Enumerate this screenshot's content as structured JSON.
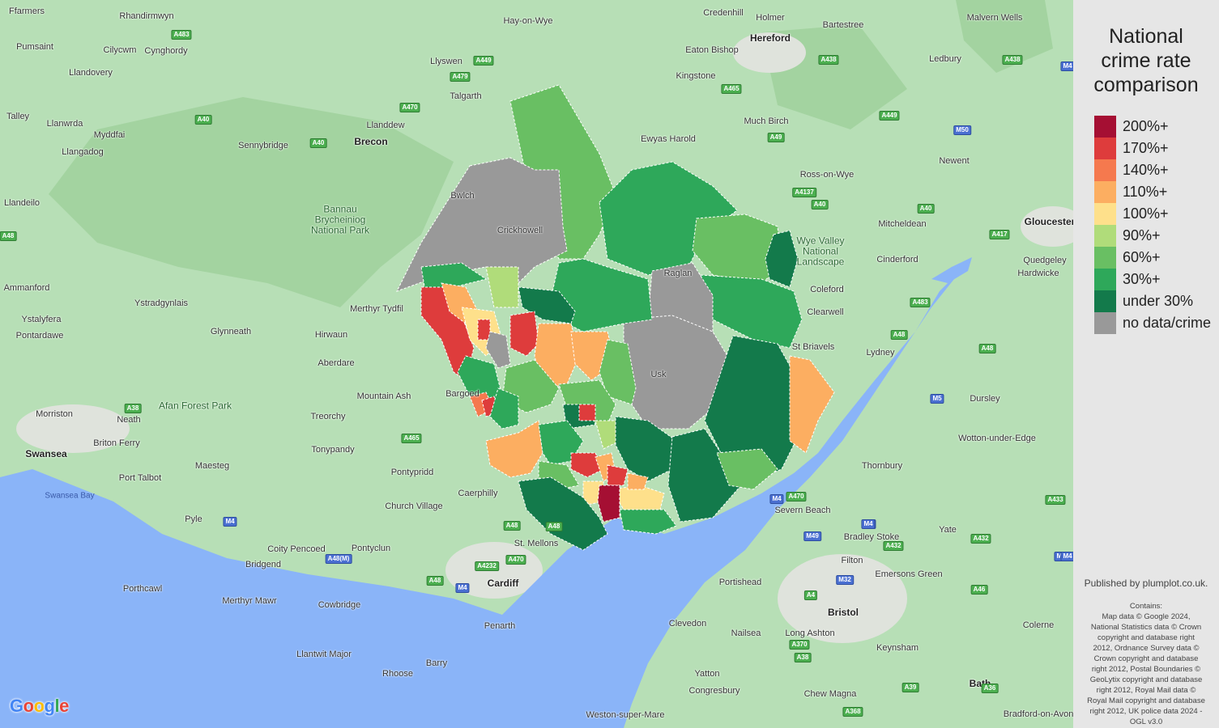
{
  "map": {
    "places": [
      {
        "name": "Ffarmers",
        "cls": ""
      },
      {
        "name": "Rhandirmwyn",
        "cls": ""
      },
      {
        "name": "Hay-on-Wye",
        "cls": ""
      },
      {
        "name": "Credenhill",
        "cls": ""
      },
      {
        "name": "Holmer",
        "cls": ""
      },
      {
        "name": "Hereford",
        "cls": "big"
      },
      {
        "name": "Bartestree",
        "cls": ""
      },
      {
        "name": "Malvern Wells",
        "cls": ""
      },
      {
        "name": "Pumsaint",
        "cls": ""
      },
      {
        "name": "Cilycwm",
        "cls": ""
      },
      {
        "name": "Cynghordy",
        "cls": ""
      },
      {
        "name": "Llyswen",
        "cls": ""
      },
      {
        "name": "Eaton Bishop",
        "cls": ""
      },
      {
        "name": "Ledbury",
        "cls": ""
      },
      {
        "name": "Llandovery",
        "cls": ""
      },
      {
        "name": "Talgarth",
        "cls": ""
      },
      {
        "name": "Kingstone",
        "cls": ""
      },
      {
        "name": "Talley",
        "cls": ""
      },
      {
        "name": "Llanwrda",
        "cls": ""
      },
      {
        "name": "Much Birch",
        "cls": ""
      },
      {
        "name": "Myddfai",
        "cls": ""
      },
      {
        "name": "Llanddew",
        "cls": ""
      },
      {
        "name": "Llangadog",
        "cls": ""
      },
      {
        "name": "Sennybridge",
        "cls": ""
      },
      {
        "name": "Brecon",
        "cls": "big"
      },
      {
        "name": "Ewyas Harold",
        "cls": ""
      },
      {
        "name": "Ross-on-Wye",
        "cls": ""
      },
      {
        "name": "Newent",
        "cls": ""
      },
      {
        "name": "Llandeilo",
        "cls": ""
      },
      {
        "name": "Bwlch",
        "cls": ""
      },
      {
        "name": "Crickhowell",
        "cls": ""
      },
      {
        "name": "Mitcheldean",
        "cls": ""
      },
      {
        "name": "Gloucester",
        "cls": "big"
      },
      {
        "name": "Cinderford",
        "cls": ""
      },
      {
        "name": "Quedgeley",
        "cls": ""
      },
      {
        "name": "Hardwicke",
        "cls": ""
      },
      {
        "name": "Coleford",
        "cls": ""
      },
      {
        "name": "Ammanford",
        "cls": ""
      },
      {
        "name": "Ystradgynlais",
        "cls": ""
      },
      {
        "name": "Clearwell",
        "cls": ""
      },
      {
        "name": "Ystalyfera",
        "cls": ""
      },
      {
        "name": "Merthyr Tydfil",
        "cls": ""
      },
      {
        "name": "Raglan",
        "cls": ""
      },
      {
        "name": "Glynneath",
        "cls": ""
      },
      {
        "name": "Hirwaun",
        "cls": ""
      },
      {
        "name": "Pontardawe",
        "cls": ""
      },
      {
        "name": "St Briavels",
        "cls": ""
      },
      {
        "name": "Lydney",
        "cls": ""
      },
      {
        "name": "Aberdare",
        "cls": ""
      },
      {
        "name": "Usk",
        "cls": ""
      },
      {
        "name": "Mountain Ash",
        "cls": ""
      },
      {
        "name": "Dursley",
        "cls": ""
      },
      {
        "name": "Bargoed",
        "cls": ""
      },
      {
        "name": "Morriston",
        "cls": ""
      },
      {
        "name": "Neath",
        "cls": ""
      },
      {
        "name": "Treorchy",
        "cls": ""
      },
      {
        "name": "Wotton-under-Edge",
        "cls": ""
      },
      {
        "name": "Swansea",
        "cls": "big"
      },
      {
        "name": "Briton Ferry",
        "cls": ""
      },
      {
        "name": "Tonypandy",
        "cls": ""
      },
      {
        "name": "Thornbury",
        "cls": ""
      },
      {
        "name": "Maesteg",
        "cls": ""
      },
      {
        "name": "Port Talbot",
        "cls": ""
      },
      {
        "name": "Pontypridd",
        "cls": ""
      },
      {
        "name": "Caerphilly",
        "cls": ""
      },
      {
        "name": "Church Village",
        "cls": ""
      },
      {
        "name": "Severn Beach",
        "cls": ""
      },
      {
        "name": "Yate",
        "cls": ""
      },
      {
        "name": "Pyle",
        "cls": ""
      },
      {
        "name": "St. Mellons",
        "cls": ""
      },
      {
        "name": "Bradley Stoke",
        "cls": ""
      },
      {
        "name": "Coity Pencoed",
        "cls": ""
      },
      {
        "name": "Pontyclun",
        "cls": ""
      },
      {
        "name": "Bridgend",
        "cls": ""
      },
      {
        "name": "Filton",
        "cls": ""
      },
      {
        "name": "Emersons Green",
        "cls": ""
      },
      {
        "name": "Porthcawl",
        "cls": ""
      },
      {
        "name": "Merthyr Mawr",
        "cls": ""
      },
      {
        "name": "Cardiff",
        "cls": "big"
      },
      {
        "name": "Portishead",
        "cls": ""
      },
      {
        "name": "Cowbridge",
        "cls": ""
      },
      {
        "name": "Bristol",
        "cls": "big"
      },
      {
        "name": "Clevedon",
        "cls": ""
      },
      {
        "name": "Penarth",
        "cls": ""
      },
      {
        "name": "Nailsea",
        "cls": ""
      },
      {
        "name": "Long Ashton",
        "cls": ""
      },
      {
        "name": "Keynsham",
        "cls": ""
      },
      {
        "name": "Colerne",
        "cls": ""
      },
      {
        "name": "Llantwit Major",
        "cls": ""
      },
      {
        "name": "Barry",
        "cls": ""
      },
      {
        "name": "Rhoose",
        "cls": ""
      },
      {
        "name": "Yatton",
        "cls": ""
      },
      {
        "name": "Bath",
        "cls": "big"
      },
      {
        "name": "Congresbury",
        "cls": ""
      },
      {
        "name": "Chew Magna",
        "cls": ""
      },
      {
        "name": "Weston-super-Mare",
        "cls": ""
      },
      {
        "name": "Bradford-on-Avon",
        "cls": ""
      },
      {
        "name": "Swansea Bay",
        "cls": "water"
      },
      {
        "name": "Afan Forest Park",
        "cls": "park"
      },
      {
        "name": "Bannau Brycheiniog National Park",
        "cls": "park"
      },
      {
        "name": "Wye Valley National Landscape",
        "cls": "park"
      }
    ],
    "roads": [
      {
        "label": "A483",
        "cls": ""
      },
      {
        "label": "A438",
        "cls": ""
      },
      {
        "label": "A438",
        "cls": ""
      },
      {
        "label": "A449",
        "cls": ""
      },
      {
        "label": "A479",
        "cls": ""
      },
      {
        "label": "A470",
        "cls": ""
      },
      {
        "label": "A40",
        "cls": ""
      },
      {
        "label": "A40",
        "cls": ""
      },
      {
        "label": "A465",
        "cls": ""
      },
      {
        "label": "A49",
        "cls": ""
      },
      {
        "label": "A449",
        "cls": ""
      },
      {
        "label": "M50",
        "cls": "blue"
      },
      {
        "label": "A4137",
        "cls": ""
      },
      {
        "label": "A40",
        "cls": ""
      },
      {
        "label": "A40",
        "cls": ""
      },
      {
        "label": "A417",
        "cls": ""
      },
      {
        "label": "A48",
        "cls": ""
      },
      {
        "label": "A483",
        "cls": ""
      },
      {
        "label": "A48",
        "cls": ""
      },
      {
        "label": "A48",
        "cls": ""
      },
      {
        "label": "M5",
        "cls": "blue"
      },
      {
        "label": "A38",
        "cls": ""
      },
      {
        "label": "A465",
        "cls": ""
      },
      {
        "label": "A470",
        "cls": ""
      },
      {
        "label": "A48",
        "cls": ""
      },
      {
        "label": "M4",
        "cls": "blue"
      },
      {
        "label": "M4",
        "cls": "blue"
      },
      {
        "label": "M4",
        "cls": "blue"
      },
      {
        "label": "A48(M)",
        "cls": "blue"
      },
      {
        "label": "A48",
        "cls": ""
      },
      {
        "label": "A470",
        "cls": ""
      },
      {
        "label": "A4232",
        "cls": ""
      },
      {
        "label": "A48",
        "cls": ""
      },
      {
        "label": "M4",
        "cls": "blue"
      },
      {
        "label": "M4",
        "cls": "blue"
      },
      {
        "label": "M49",
        "cls": "blue"
      },
      {
        "label": "M4",
        "cls": "blue"
      },
      {
        "label": "A432",
        "cls": ""
      },
      {
        "label": "A432",
        "cls": ""
      },
      {
        "label": "A433",
        "cls": ""
      },
      {
        "label": "M32",
        "cls": "blue"
      },
      {
        "label": "A4",
        "cls": ""
      },
      {
        "label": "A46",
        "cls": ""
      },
      {
        "label": "A370",
        "cls": ""
      },
      {
        "label": "A38",
        "cls": ""
      },
      {
        "label": "A39",
        "cls": ""
      },
      {
        "label": "A36",
        "cls": ""
      },
      {
        "label": "A368",
        "cls": ""
      },
      {
        "label": "M4",
        "cls": "blue"
      },
      {
        "label": "M4",
        "cls": "blue"
      }
    ],
    "attribution_logo": "Google",
    "colors": {
      "land": "#a9d9a6",
      "land_light": "#bfe4c0",
      "water": "#8ab4f8",
      "urban": "#e4e7e0"
    }
  },
  "legend": {
    "title_lines": [
      "National",
      "crime rate",
      "comparison"
    ],
    "items": [
      {
        "label": "200%+",
        "color": "#a50f33"
      },
      {
        "label": "170%+",
        "color": "#de3c3c"
      },
      {
        "label": "140%+",
        "color": "#f5794e"
      },
      {
        "label": "110%+",
        "color": "#fcae61"
      },
      {
        "label": "100%+",
        "color": "#fee08b"
      },
      {
        "label": "90%+",
        "color": "#b0dc7a"
      },
      {
        "label": "60%+",
        "color": "#69bf63"
      },
      {
        "label": "30%+",
        "color": "#2ea85a"
      },
      {
        "label": "under 30%",
        "color": "#137a4b"
      },
      {
        "label": "no data/crime",
        "color": "#999999"
      }
    ]
  },
  "credits": {
    "published": "Published by plumplot.co.uk.",
    "contains": "Contains:\nMap data © Google 2024,\nNational Statistics data © Crown\ncopyright and database right\n2012, Ordnance Survey data ©\nCrown copyright and database\nright 2012, Postal Boundaries ©\nGeoLytix copyright and database\nright 2012, Royal Mail data ©\nRoyal Mail copyright and database\nright 2012, UK police data 2024 -\nOGL v3.0"
  }
}
